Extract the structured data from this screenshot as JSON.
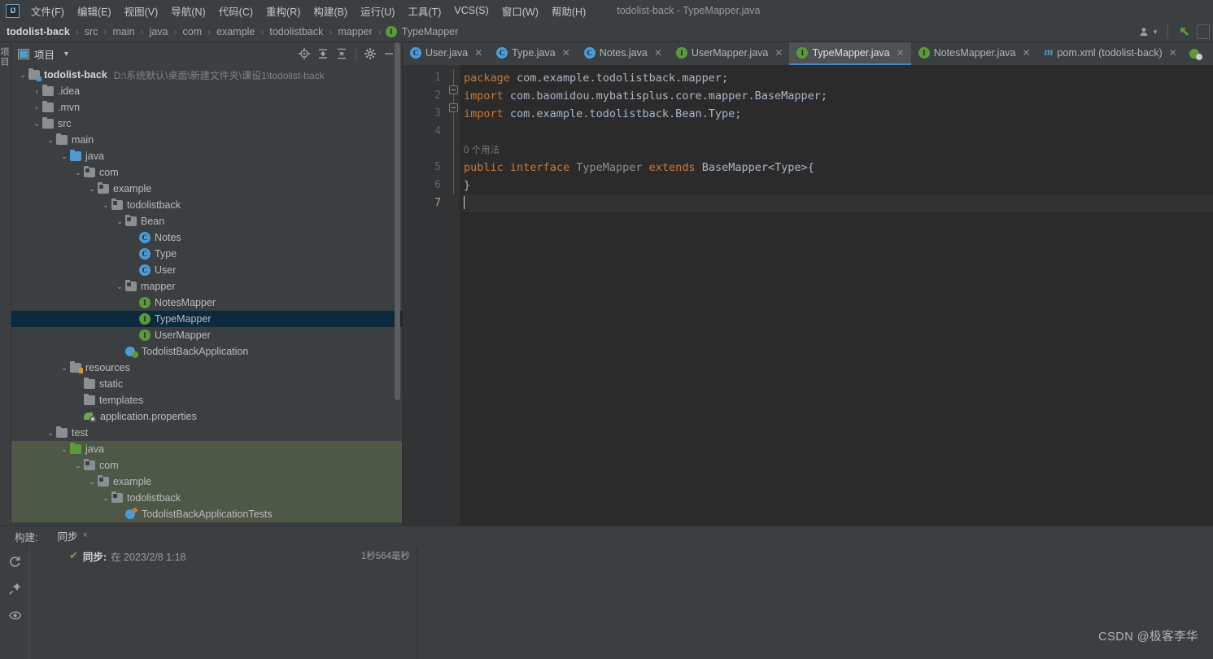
{
  "window": {
    "title": "todolist-back - TypeMapper.java",
    "logo": "ij-logo"
  },
  "menubar": {
    "items": [
      {
        "label": "文件(F)",
        "name": "menu-file"
      },
      {
        "label": "编辑(E)",
        "name": "menu-edit"
      },
      {
        "label": "视图(V)",
        "name": "menu-view"
      },
      {
        "label": "导航(N)",
        "name": "menu-navigate"
      },
      {
        "label": "代码(C)",
        "name": "menu-code"
      },
      {
        "label": "重构(R)",
        "name": "menu-refactor"
      },
      {
        "label": "构建(B)",
        "name": "menu-build"
      },
      {
        "label": "运行(U)",
        "name": "menu-run"
      },
      {
        "label": "工具(T)",
        "name": "menu-tools"
      },
      {
        "label": "VCS(S)",
        "name": "menu-vcs"
      },
      {
        "label": "窗口(W)",
        "name": "menu-window"
      },
      {
        "label": "帮助(H)",
        "name": "menu-help"
      }
    ]
  },
  "breadcrumb": {
    "separator": "›",
    "items": [
      {
        "label": "todolist-back",
        "icon": ""
      },
      {
        "label": "src",
        "icon": ""
      },
      {
        "label": "main",
        "icon": ""
      },
      {
        "label": "java",
        "icon": ""
      },
      {
        "label": "com",
        "icon": ""
      },
      {
        "label": "example",
        "icon": ""
      },
      {
        "label": "todolistback",
        "icon": ""
      },
      {
        "label": "mapper",
        "icon": ""
      },
      {
        "label": "TypeMapper",
        "icon": "interface-icon"
      }
    ]
  },
  "navbar_right": {
    "buttons": [
      "user-settings-icon",
      "updates-arrow-icon",
      "search-box"
    ]
  },
  "project_panel": {
    "tab_label": "项目",
    "vertical_tab": "项目",
    "toolbar": [
      {
        "name": "locate-file-icon",
        "title": "select-opened-file"
      },
      {
        "name": "expand-all-icon",
        "title": "expand-all"
      },
      {
        "name": "collapse-all-icon",
        "title": "collapse-all"
      },
      {
        "name": "gear-icon",
        "title": "settings"
      },
      {
        "name": "minimize-icon",
        "title": "hide"
      }
    ],
    "tree": [
      {
        "label": "todolist-back",
        "path": "D:\\系统默认\\桌面\\新建文件夹\\课设1\\todolist-back",
        "indent": 0,
        "arrow": "down",
        "icon": "module-folder",
        "bold": true
      },
      {
        "label": ".idea",
        "indent": 1,
        "arrow": "right",
        "icon": "folder"
      },
      {
        "label": ".mvn",
        "indent": 1,
        "arrow": "right",
        "icon": "folder"
      },
      {
        "label": "src",
        "indent": 1,
        "arrow": "down",
        "icon": "folder"
      },
      {
        "label": "main",
        "indent": 2,
        "arrow": "down",
        "icon": "folder"
      },
      {
        "label": "java",
        "indent": 3,
        "arrow": "down",
        "icon": "source-folder"
      },
      {
        "label": "com",
        "indent": 4,
        "arrow": "down",
        "icon": "package"
      },
      {
        "label": "example",
        "indent": 5,
        "arrow": "down",
        "icon": "package"
      },
      {
        "label": "todolistback",
        "indent": 6,
        "arrow": "down",
        "icon": "package"
      },
      {
        "label": "Bean",
        "indent": 7,
        "arrow": "down",
        "icon": "package"
      },
      {
        "label": "Notes",
        "indent": 8,
        "arrow": "none",
        "icon": "class"
      },
      {
        "label": "Type",
        "indent": 8,
        "arrow": "none",
        "icon": "class"
      },
      {
        "label": "User",
        "indent": 8,
        "arrow": "none",
        "icon": "class"
      },
      {
        "label": "mapper",
        "indent": 7,
        "arrow": "down",
        "icon": "package"
      },
      {
        "label": "NotesMapper",
        "indent": 8,
        "arrow": "none",
        "icon": "interface"
      },
      {
        "label": "TypeMapper",
        "indent": 8,
        "arrow": "none",
        "icon": "interface",
        "selected": true
      },
      {
        "label": "UserMapper",
        "indent": 8,
        "arrow": "none",
        "icon": "interface"
      },
      {
        "label": "TodolistBackApplication",
        "indent": 7,
        "arrow": "none",
        "icon": "spring-run"
      },
      {
        "label": "resources",
        "indent": 3,
        "arrow": "down",
        "icon": "resources-folder"
      },
      {
        "label": "static",
        "indent": 4,
        "arrow": "none",
        "icon": "folder"
      },
      {
        "label": "templates",
        "indent": 4,
        "arrow": "none",
        "icon": "folder"
      },
      {
        "label": "application.properties",
        "indent": 4,
        "arrow": "none",
        "icon": "properties"
      },
      {
        "label": "test",
        "indent": 2,
        "arrow": "down",
        "icon": "folder"
      },
      {
        "label": "java",
        "indent": 3,
        "arrow": "down",
        "icon": "test-source-folder",
        "ctx": true
      },
      {
        "label": "com",
        "indent": 4,
        "arrow": "down",
        "icon": "package",
        "ctx": true
      },
      {
        "label": "example",
        "indent": 5,
        "arrow": "down",
        "icon": "package",
        "ctx": true
      },
      {
        "label": "todolistback",
        "indent": 6,
        "arrow": "down",
        "icon": "package",
        "ctx": true
      },
      {
        "label": "TodolistBackApplicationTests",
        "indent": 7,
        "arrow": "none",
        "icon": "test-class",
        "ctx": true
      }
    ]
  },
  "editor_tabs": [
    {
      "label": "User.java",
      "icon": "class-icon",
      "active": false
    },
    {
      "label": "Type.java",
      "icon": "class-icon",
      "active": false
    },
    {
      "label": "Notes.java",
      "icon": "class-icon",
      "active": false
    },
    {
      "label": "UserMapper.java",
      "icon": "interface-icon",
      "active": false
    },
    {
      "label": "TypeMapper.java",
      "icon": "interface-icon",
      "active": true
    },
    {
      "label": "NotesMapper.java",
      "icon": "interface-icon",
      "active": false
    },
    {
      "label": "pom.xml (todolist-back)",
      "icon": "maven-icon",
      "active": false
    }
  ],
  "editor": {
    "line_numbers": [
      "1",
      "2",
      "3",
      "4",
      "5",
      "6",
      "7"
    ],
    "inlay_hint": "0 个用法",
    "lines": [
      [
        {
          "t": "package",
          "c": "kw"
        },
        {
          "t": " com.example.todolistback.mapper;",
          "c": "plain"
        }
      ],
      [
        {
          "t": "import",
          "c": "kw"
        },
        {
          "t": " com.baomidou.mybatisplus.core.mapper.BaseMapper;",
          "c": "plain"
        }
      ],
      [
        {
          "t": "import",
          "c": "kw"
        },
        {
          "t": " com.example.todolistback.Bean.Type;",
          "c": "plain"
        }
      ],
      [],
      [
        {
          "t": "public",
          "c": "kw"
        },
        {
          "t": " ",
          "c": "plain"
        },
        {
          "t": "interface",
          "c": "kw"
        },
        {
          "t": " ",
          "c": "plain"
        },
        {
          "t": "TypeMapper",
          "c": "ident-grey"
        },
        {
          "t": " ",
          "c": "plain"
        },
        {
          "t": "extends",
          "c": "kw"
        },
        {
          "t": " ",
          "c": "plain"
        },
        {
          "t": "BaseMapper<Type>{",
          "c": "plain"
        }
      ],
      [
        {
          "t": "}",
          "c": "plain"
        }
      ],
      []
    ]
  },
  "bottom_panel": {
    "title": "构建:",
    "tab": {
      "label": "同步",
      "close": "×"
    },
    "toolbar_icons": [
      "refresh-icon",
      "pin-icon",
      "eye-icon"
    ],
    "result": {
      "status_icon": "check-icon",
      "label": "同步:",
      "detail": "在 2023/2/8 1:18",
      "duration": "1秒564毫秒"
    }
  },
  "watermark": "CSDN @极客李华",
  "colors": {
    "bg": "#3c3f41",
    "editor_bg": "#2b2b2b",
    "gutter_bg": "#313335",
    "selection": "#0d293e",
    "test_ctx": "#4e5847",
    "accent_tab": "#4a88c7",
    "keyword": "#cc7832",
    "plain_code": "#a9b7c6",
    "class_icon": "#4d9bd4",
    "interface_icon": "#5a9a3c"
  }
}
